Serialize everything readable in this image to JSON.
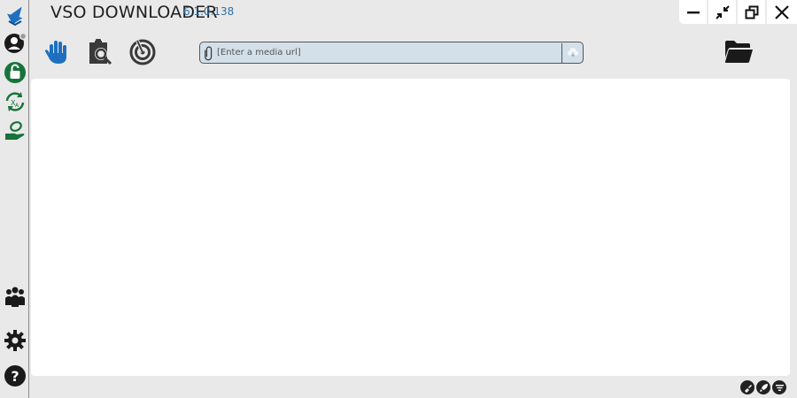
{
  "app": {
    "title": "VSO DOWNLOADER",
    "version": "6.1.0.138"
  },
  "colors": {
    "background": "#e9e9e9",
    "content": "#ffffff",
    "accent_blue": "#1e6fc0",
    "version_blue": "#2f6fa1",
    "green": "#17733a",
    "url_bg": "#d3e0ea",
    "icon_dark": "#222222"
  },
  "sidebar": {
    "items": [
      {
        "name": "download-arrow-icon"
      },
      {
        "name": "user-account-icon"
      },
      {
        "name": "unlock-icon"
      },
      {
        "name": "convert-icon"
      },
      {
        "name": "money-hand-icon"
      },
      {
        "name": "community-icon"
      },
      {
        "name": "settings-gear-icon"
      },
      {
        "name": "help-icon"
      }
    ]
  },
  "toolbar": {
    "buttons": [
      {
        "name": "stop-hand-icon"
      },
      {
        "name": "clipboard-search-icon"
      },
      {
        "name": "radar-icon"
      }
    ]
  },
  "url_bar": {
    "placeholder": "[Enter a media url]",
    "value": ""
  },
  "status": {
    "icons": [
      "brush-icon",
      "rocket-icon",
      "filter-icon"
    ]
  }
}
